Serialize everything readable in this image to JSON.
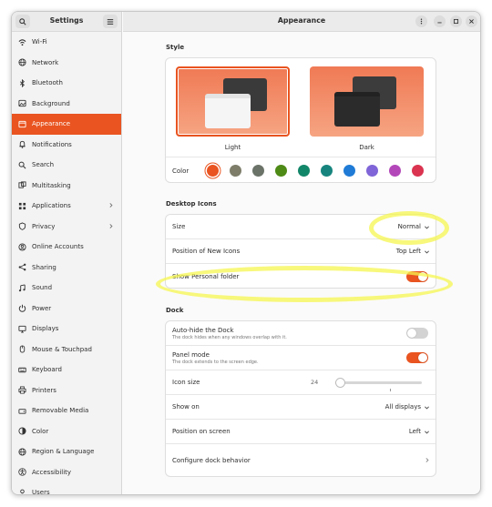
{
  "colors": {
    "accent": "#e95420"
  },
  "sidebar": {
    "title": "Settings",
    "items": [
      {
        "label": "Wi-Fi",
        "icon": "wifi-icon"
      },
      {
        "label": "Network",
        "icon": "network-icon"
      },
      {
        "label": "Bluetooth",
        "icon": "bluetooth-icon"
      },
      {
        "label": "Background",
        "icon": "background-icon"
      },
      {
        "label": "Appearance",
        "icon": "appearance-icon",
        "active": true
      },
      {
        "label": "Notifications",
        "icon": "bell-icon"
      },
      {
        "label": "Search",
        "icon": "search-icon"
      },
      {
        "label": "Multitasking",
        "icon": "multitasking-icon"
      },
      {
        "label": "Applications",
        "icon": "applications-icon",
        "chevron": true
      },
      {
        "label": "Privacy",
        "icon": "privacy-icon",
        "chevron": true
      },
      {
        "label": "Online Accounts",
        "icon": "online-accounts-icon"
      },
      {
        "label": "Sharing",
        "icon": "sharing-icon"
      },
      {
        "label": "Sound",
        "icon": "sound-icon"
      },
      {
        "label": "Power",
        "icon": "power-icon"
      },
      {
        "label": "Displays",
        "icon": "displays-icon"
      },
      {
        "label": "Mouse & Touchpad",
        "icon": "mouse-icon"
      },
      {
        "label": "Keyboard",
        "icon": "keyboard-icon"
      },
      {
        "label": "Printers",
        "icon": "printer-icon"
      },
      {
        "label": "Removable Media",
        "icon": "removable-media-icon"
      },
      {
        "label": "Color",
        "icon": "color-icon"
      },
      {
        "label": "Region & Language",
        "icon": "globe-icon"
      },
      {
        "label": "Accessibility",
        "icon": "accessibility-icon"
      },
      {
        "label": "Users",
        "icon": "users-icon"
      }
    ]
  },
  "main": {
    "title": "Appearance",
    "style": {
      "section": "Style",
      "light_label": "Light",
      "dark_label": "Dark",
      "color_label": "Color",
      "swatches": [
        "#e95420",
        "#7d7d6a",
        "#6b7369",
        "#4e8a16",
        "#128668",
        "#17857e",
        "#1f7bd6",
        "#7f65d7",
        "#b347b9",
        "#da3450"
      ],
      "selected_swatch": 0
    },
    "desktop_icons": {
      "section": "Desktop Icons",
      "size_label": "Size",
      "size_value": "Normal",
      "position_label": "Position of New Icons",
      "position_value": "Top Left",
      "personal_folder_label": "Show Personal folder",
      "personal_folder_on": true
    },
    "dock": {
      "section": "Dock",
      "autohide_label": "Auto-hide the Dock",
      "autohide_sub": "The dock hides when any windows overlap with it.",
      "autohide_on": false,
      "panel_label": "Panel mode",
      "panel_sub": "The dock extends to the screen edge.",
      "panel_on": true,
      "icon_size_label": "Icon size",
      "icon_size_value": "24",
      "icon_size_fraction": 0.05,
      "show_on_label": "Show on",
      "show_on_value": "All displays",
      "position_label": "Position on screen",
      "position_value": "Left",
      "configure_label": "Configure dock behavior"
    }
  }
}
